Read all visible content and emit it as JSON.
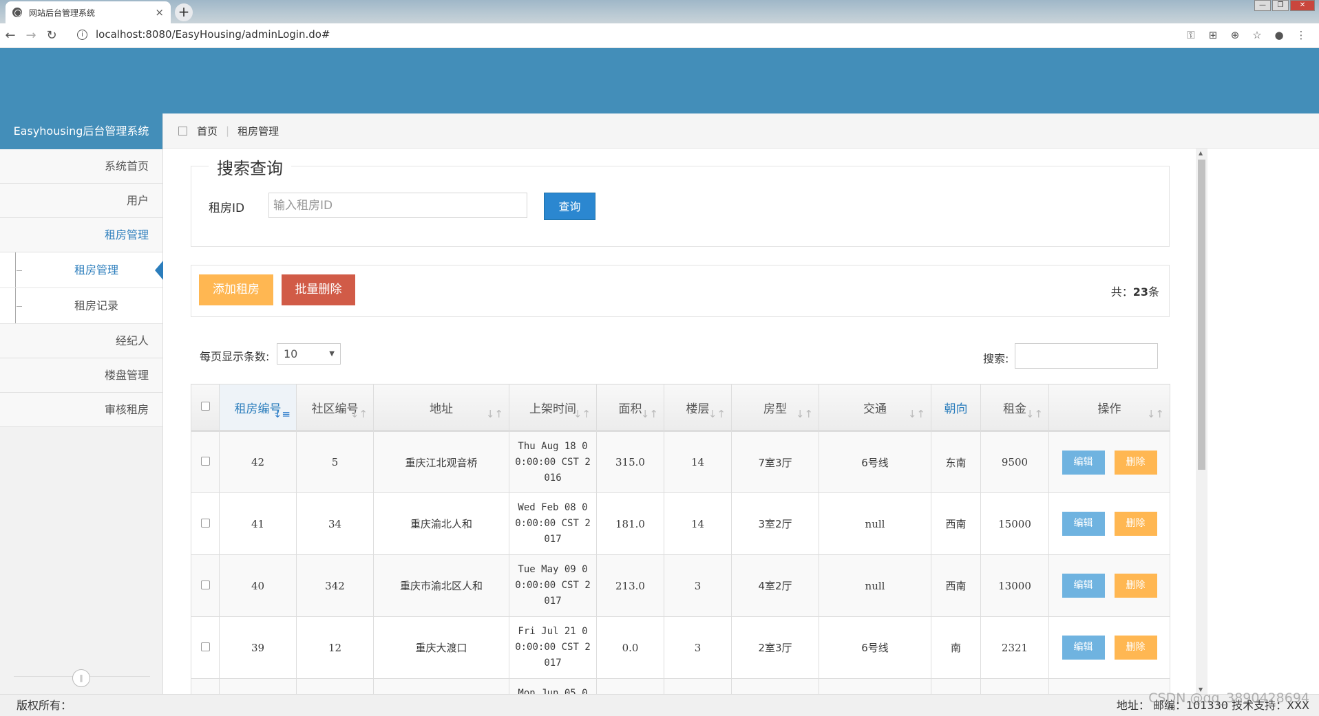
{
  "browser": {
    "tab_title": "网站后台管理系统",
    "tab_close": "×",
    "new_tab": "+",
    "url": "localhost:8080/EasyHousing/adminLogin.do#",
    "win_min": "—",
    "win_max": "❐",
    "win_close": "✕"
  },
  "sidebar": {
    "title": "Easyhousing后台管理系统",
    "items": [
      {
        "label": "系统首页"
      },
      {
        "label": "用户"
      },
      {
        "label": "租房管理"
      },
      {
        "label": "经纪人"
      },
      {
        "label": "楼盘管理"
      },
      {
        "label": "审核租房"
      }
    ],
    "subitems": [
      {
        "label": "租房管理"
      },
      {
        "label": "租房记录"
      }
    ],
    "collapse_icon": "‖"
  },
  "breadcrumb": {
    "home": "首页",
    "separator": "|",
    "current": "租房管理"
  },
  "search": {
    "legend": "搜索查询",
    "label": "租房ID",
    "placeholder": "输入租房ID",
    "button": "查询"
  },
  "actions": {
    "add": "添加租房",
    "batch_delete": "批量删除",
    "total_prefix": "共：",
    "total_count": "23",
    "total_suffix": "条"
  },
  "table_controls": {
    "page_size_label": "每页显示条数:",
    "page_size_value": "10",
    "filter_label": "搜索:"
  },
  "table": {
    "headers": {
      "id": "租房编号",
      "community": "社区编号",
      "address": "地址",
      "listed": "上架时间",
      "area": "面积",
      "floor": "楼层",
      "layout": "房型",
      "traffic": "交通",
      "orientation": "朝向",
      "rent": "租金",
      "actions": "操作"
    },
    "edit_label": "编辑",
    "delete_label": "删除",
    "rows": [
      {
        "id": "42",
        "community": "5",
        "address": "重庆江北观音桥",
        "listed": "Thu Aug 18 00:00:00 CST 2016",
        "area": "315.0",
        "floor": "14",
        "layout": "7室3厅",
        "traffic": "6号线",
        "orientation": "东南",
        "rent": "9500"
      },
      {
        "id": "41",
        "community": "34",
        "address": "重庆渝北人和",
        "listed": "Wed Feb 08 00:00:00 CST 2017",
        "area": "181.0",
        "floor": "14",
        "layout": "3室2厅",
        "traffic": "null",
        "orientation": "西南",
        "rent": "15000"
      },
      {
        "id": "40",
        "community": "342",
        "address": "重庆市渝北区人和",
        "listed": "Tue May 09 00:00:00 CST 2017",
        "area": "213.0",
        "floor": "3",
        "layout": "4室2厅",
        "traffic": "null",
        "orientation": "西南",
        "rent": "13000"
      },
      {
        "id": "39",
        "community": "12",
        "address": "重庆大渡口",
        "listed": "Fri Jul 21 00:00:00 CST 2017",
        "area": "0.0",
        "floor": "3",
        "layout": "2室3厅",
        "traffic": "6号线",
        "orientation": "南",
        "rent": "2321"
      },
      {
        "id": "",
        "community": "",
        "address": "",
        "listed": "Mon Jun 05 0",
        "area": "",
        "floor": "",
        "layout": "",
        "traffic": "",
        "orientation": "",
        "rent": ""
      }
    ]
  },
  "footer": {
    "left": "版权所有：",
    "right": "地址：  邮编：101330  技术支持：XXX",
    "watermark": "CSDN @qq_3890428694"
  },
  "colors": {
    "header": "#438eb9",
    "primary": "#2b87d0",
    "warning": "#ffb752",
    "danger": "#d15b47",
    "info": "#6fb3e0"
  }
}
